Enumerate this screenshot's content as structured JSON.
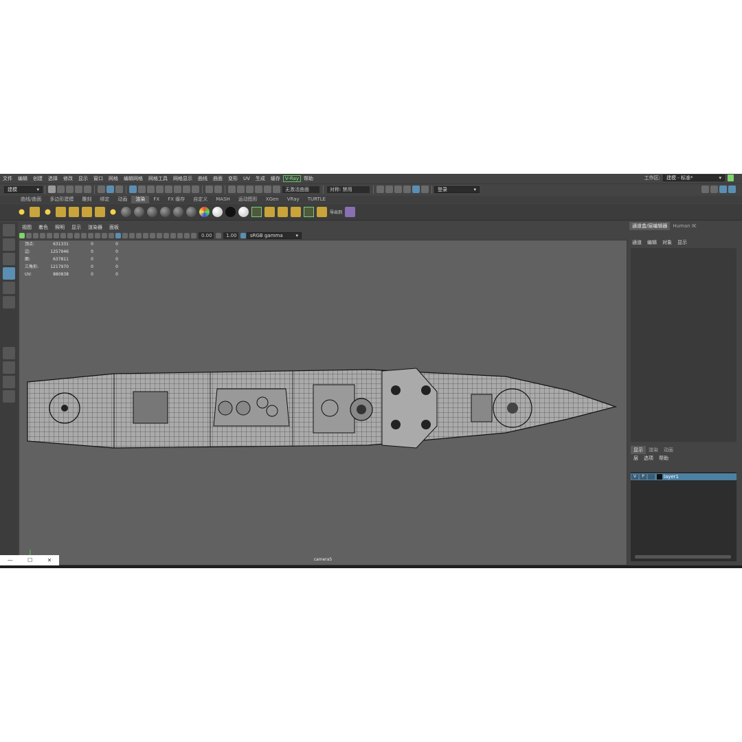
{
  "menu": [
    "文件",
    "编辑",
    "创建",
    "选择",
    "修改",
    "显示",
    "窗口",
    "网格",
    "编辑网格",
    "网格工具",
    "网格显示",
    "曲线",
    "曲面",
    "变形",
    "UV",
    "生成",
    "缓存",
    "V-Ray",
    "帮助"
  ],
  "workspace": {
    "label": "工作区:",
    "value": "建模 - 标准*"
  },
  "statusline": {
    "mode": "建模",
    "live_surface": "无激活曲面",
    "symmetry": "对称: 禁用",
    "login": "登录"
  },
  "shelf_tabs": [
    "曲线/曲面",
    "多边形建模",
    "雕刻",
    "绑定",
    "动画",
    "渲染",
    "FX",
    "FX 缓存",
    "自定义",
    "MASH",
    "运动图形",
    "XGen",
    "VRay",
    "TURTLE"
  ],
  "shelf_active": "渲染",
  "shelf_extra": "导出到",
  "viewport": {
    "menu": [
      "视图",
      "着色",
      "照明",
      "显示",
      "渲染器",
      "面板"
    ],
    "exposure": "0.00",
    "gamma": "1.00",
    "colorspace": "sRGB gamma",
    "camera": "camera5",
    "hud": [
      {
        "label": "顶点:",
        "v1": "631331",
        "v2": "0",
        "v3": "0"
      },
      {
        "label": "边:",
        "v1": "1257946",
        "v2": "0",
        "v3": "0"
      },
      {
        "label": "面:",
        "v1": "637811",
        "v2": "0",
        "v3": "0"
      },
      {
        "label": "三角形:",
        "v1": "1217970",
        "v2": "0",
        "v3": "0"
      },
      {
        "label": "UV:",
        "v1": "880838",
        "v2": "0",
        "v3": "0"
      }
    ]
  },
  "right_panel": {
    "tabs": [
      "通道盒/层编辑器",
      "Human IK"
    ],
    "menu": [
      "通道",
      "编辑",
      "对象",
      "显示"
    ],
    "layer_tabs": [
      "显示",
      "渲染",
      "动画"
    ],
    "layer_menu": [
      "层",
      "选项",
      "帮助"
    ],
    "layer": {
      "v": "V",
      "p": "P",
      "name": "layer1"
    }
  },
  "colors": {
    "background": "#444444",
    "viewport": "#616161",
    "accent": "#5a8fb3",
    "vray": "#7df07d"
  }
}
